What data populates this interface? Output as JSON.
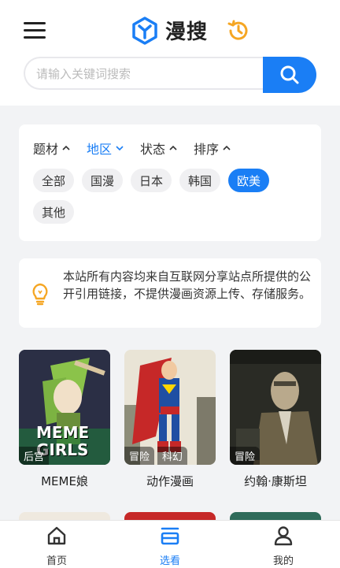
{
  "header": {
    "app_name": "漫搜"
  },
  "search": {
    "placeholder": "请输入关键词搜索"
  },
  "filters": {
    "categories": [
      {
        "label": "题材",
        "active": false
      },
      {
        "label": "地区",
        "active": true
      },
      {
        "label": "状态",
        "active": false
      },
      {
        "label": "排序",
        "active": false
      }
    ],
    "chips": [
      {
        "label": "全部",
        "active": false
      },
      {
        "label": "国漫",
        "active": false
      },
      {
        "label": "日本",
        "active": false
      },
      {
        "label": "韩国",
        "active": false
      },
      {
        "label": "欧美",
        "active": true
      },
      {
        "label": "其他",
        "active": false
      }
    ]
  },
  "notice": {
    "text": "本站所有内容均来自互联网分享站点所提供的公开引用链接，不提供漫画资源上传、存储服务。"
  },
  "comics": [
    {
      "title": "MEME娘",
      "tags": [
        "后宫"
      ],
      "cover_text": "MEME GIRLS"
    },
    {
      "title": "动作漫画",
      "tags": [
        "冒险",
        "科幻"
      ]
    },
    {
      "title": "约翰·康斯坦",
      "tags": [
        "冒险"
      ]
    }
  ],
  "tabbar": [
    {
      "label": "首页",
      "icon": "home-icon",
      "active": false
    },
    {
      "label": "选看",
      "icon": "list-icon",
      "active": true
    },
    {
      "label": "我的",
      "icon": "user-icon",
      "active": false
    }
  ],
  "colors": {
    "accent": "#1a7ef5",
    "history": "#f5a623",
    "bulb": "#f5a623"
  }
}
